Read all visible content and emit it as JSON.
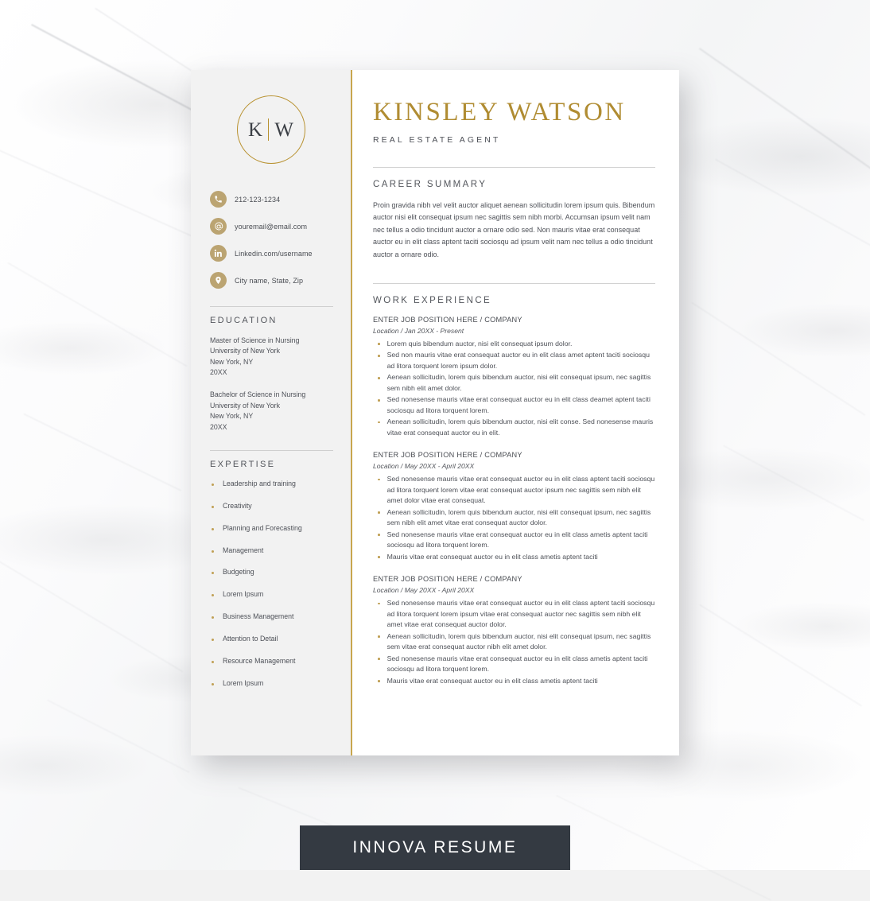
{
  "background": {
    "texture": "white-marble",
    "page_shadow": true
  },
  "colors": {
    "gold": "#b08c32",
    "gold_icon": "#bba472",
    "gold_divider": "#c8a64e",
    "sidebar_bg": "#f2f2f2",
    "paper_bg": "#ffffff",
    "text": "#4e5158",
    "banner_bg": "#343a42"
  },
  "sidebar": {
    "monogram": {
      "left_initial": "K",
      "right_initial": "W"
    },
    "contacts": [
      {
        "icon": "phone-icon",
        "text": "212-123-1234"
      },
      {
        "icon": "email-icon",
        "text": "youremail@email.com"
      },
      {
        "icon": "linkedin-icon",
        "text": "Linkedin.com/username"
      },
      {
        "icon": "location-pin-icon",
        "text": "City name, State, Zip"
      }
    ],
    "education": {
      "title": "EDUCATION",
      "entries": [
        {
          "degree": "Master of Science in Nursing",
          "school": "University of New York",
          "city": "New York, NY",
          "year": "20XX"
        },
        {
          "degree": "Bachelor of Science in Nursing",
          "school": "University of New York",
          "city": "New York, NY",
          "year": "20XX"
        }
      ]
    },
    "expertise": {
      "title": "EXPERTISE",
      "items": [
        "Leadership and training",
        "Creativity",
        "Planning and Forecasting",
        "Management",
        "Budgeting",
        "Lorem Ipsum",
        "Business Management",
        "Attention to Detail",
        "Resource Management",
        "Lorem Ipsum"
      ]
    }
  },
  "main": {
    "name": "KINSLEY WATSON",
    "role": "REAL ESTATE AGENT",
    "career_summary": {
      "title": "CAREER SUMMARY",
      "text": "Proin gravida nibh vel velit auctor aliquet aenean sollicitudin lorem ipsum quis. Bibendum auctor nisi elit consequat ipsum nec sagittis sem nibh morbi. Accumsan ipsum velit nam nec tellus a odio tincidunt auctor a ornare odio sed. Non mauris vitae erat consequat auctor eu in elit class aptent taciti sociosqu ad ipsum velit nam nec tellus a odio tincidunt auctor a ornare odio."
    },
    "work_experience": {
      "title": "WORK EXPERIENCE",
      "jobs": [
        {
          "title": "ENTER JOB POSITION HERE / COMPANY",
          "meta": "Location / Jan 20XX - Present",
          "bullets": [
            "Lorem quis bibendum auctor, nisi elit consequat ipsum dolor.",
            "Sed non  mauris vitae erat consequat auctor eu in elit class  amet aptent taciti sociosqu ad litora torquent lorem ipsum dolor.",
            "Aenean sollicitudin, lorem quis bibendum auctor, nisi elit consequat ipsum, nec sagittis sem nibh elit amet dolor.",
            "Sed nonesense  mauris vitae erat consequat auctor eu in elit class deamet aptent taciti sociosqu ad litora torquent lorem.",
            "Aenean sollicitudin, lorem quis bibendum auctor, nisi elit conse. Sed nonesense  mauris vitae erat consequat auctor eu in elit."
          ]
        },
        {
          "title": "ENTER JOB POSITION HERE / COMPANY",
          "meta": "Location / May 20XX - April 20XX",
          "bullets": [
            "Sed nonesense  mauris vitae erat consequat auctor eu in elit class aptent taciti sociosqu ad litora torquent lorem vitae erat consequat auctor ipsum nec sagittis sem nibh elit amet dolor vitae erat consequat.",
            "Aenean sollicitudin, lorem quis bibendum auctor, nisi elit consequat ipsum, nec sagittis sem nibh elit amet vitae erat consequat auctor dolor.",
            "Sed nonesense  mauris vitae erat consequat auctor eu in elit class ametis aptent taciti sociosqu ad litora torquent lorem.",
            "Mauris vitae erat consequat auctor eu in elit class ametis aptent taciti"
          ]
        },
        {
          "title": "ENTER JOB POSITION HERE / COMPANY",
          "meta": "Location / May 20XX - April 20XX",
          "bullets": [
            "Sed nonesense  mauris vitae erat consequat auctor eu in elit class aptent taciti sociosqu ad litora torquent lorem ipsum vitae erat consequat auctor nec sagittis sem nibh elit amet vitae erat consequat auctor dolor.",
            "Aenean sollicitudin, lorem quis bibendum auctor, nisi elit consequat ipsum, nec sagittis sem vitae erat consequat auctor nibh elit amet dolor.",
            "Sed nonesense  mauris vitae erat consequat auctor eu in elit class ametis aptent taciti sociosqu ad litora torquent lorem.",
            "Mauris vitae erat consequat auctor eu in elit class ametis aptent taciti"
          ]
        }
      ]
    }
  },
  "banner": {
    "text": "INNOVA RESUME"
  }
}
